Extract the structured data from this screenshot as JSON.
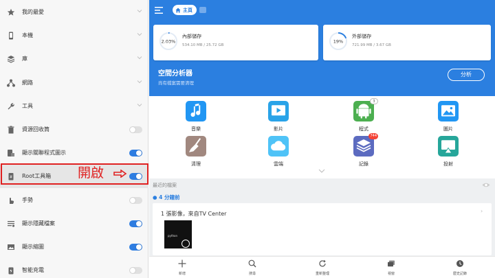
{
  "sidebar": {
    "items": [
      {
        "label": "我的最愛",
        "icon": "star-icon",
        "control": "chevron"
      },
      {
        "label": "本機",
        "icon": "phone-icon",
        "control": "chevron"
      },
      {
        "label": "庫",
        "icon": "layers-icon",
        "control": "chevron"
      },
      {
        "label": "網路",
        "icon": "network-icon",
        "control": "chevron"
      },
      {
        "label": "工具",
        "icon": "wrench-icon",
        "control": "chevron"
      },
      {
        "label": "資源回收筒",
        "icon": "trash-icon",
        "control": "toggle",
        "on": false
      },
      {
        "label": "顯示關聯程式圖示",
        "icon": "app-link-icon",
        "control": "toggle",
        "on": true
      },
      {
        "label": "Root工具箱",
        "icon": "root-toolbox-icon",
        "control": "toggle",
        "on": true
      },
      {
        "label": "手勢",
        "icon": "gesture-icon",
        "control": "toggle",
        "on": false
      },
      {
        "label": "顯示隱藏檔案",
        "icon": "hidden-files-icon",
        "control": "toggle",
        "on": true
      },
      {
        "label": "顯示縮圖",
        "icon": "thumbnail-icon",
        "control": "toggle",
        "on": true
      },
      {
        "label": "智能充電",
        "icon": "charging-icon",
        "control": "toggle",
        "on": false
      }
    ]
  },
  "annotation": {
    "text": "開啟"
  },
  "header": {
    "home_label": "主頁"
  },
  "storage": {
    "internal": {
      "title": "內部儲存",
      "percent_text": "2.03%",
      "usage": "534.10 MB / 25.72 GB",
      "fraction": 0.0203
    },
    "external": {
      "title": "外部儲存",
      "percent_text": "19%",
      "usage": "721.99 MB / 3.67 GB",
      "fraction": 0.19
    }
  },
  "analysis": {
    "title": "空間分析器",
    "subtitle": "尚有檔案需要清理",
    "button": "分析"
  },
  "categories": [
    {
      "label": "音樂",
      "icon": "music-icon",
      "color": "#2196f3"
    },
    {
      "label": "影片",
      "icon": "video-icon",
      "color": "#29a3e8"
    },
    {
      "label": "程式",
      "icon": "android-icon",
      "color": "#4caf50",
      "badge": "3",
      "badge_color": "#ffffff"
    },
    {
      "label": "圖片",
      "icon": "image-icon",
      "color": "#2196f3"
    },
    {
      "label": "清理",
      "icon": "broom-icon",
      "color": "#a1887f"
    },
    {
      "label": "雲端",
      "icon": "cloud-icon",
      "color": "#4fc3f7"
    },
    {
      "label": "記錄",
      "icon": "log-icon",
      "color": "#5c6bc0",
      "badge": "744",
      "badge_color": "#f44336"
    },
    {
      "label": "投射",
      "icon": "cast-icon",
      "color": "#26a69a"
    }
  ],
  "recent": {
    "header": "最近的檔案",
    "time_group": "4 分鐘前",
    "item_title": "1 張影像，來自TV Center",
    "thumb_text": "python"
  },
  "toolbar": {
    "items": [
      {
        "label": "新增",
        "icon": "plus-icon"
      },
      {
        "label": "搜尋",
        "icon": "search-icon"
      },
      {
        "label": "重新整理",
        "icon": "refresh-icon"
      },
      {
        "label": "視窗",
        "icon": "windows-icon"
      },
      {
        "label": "歷史記錄",
        "icon": "history-icon"
      }
    ]
  }
}
